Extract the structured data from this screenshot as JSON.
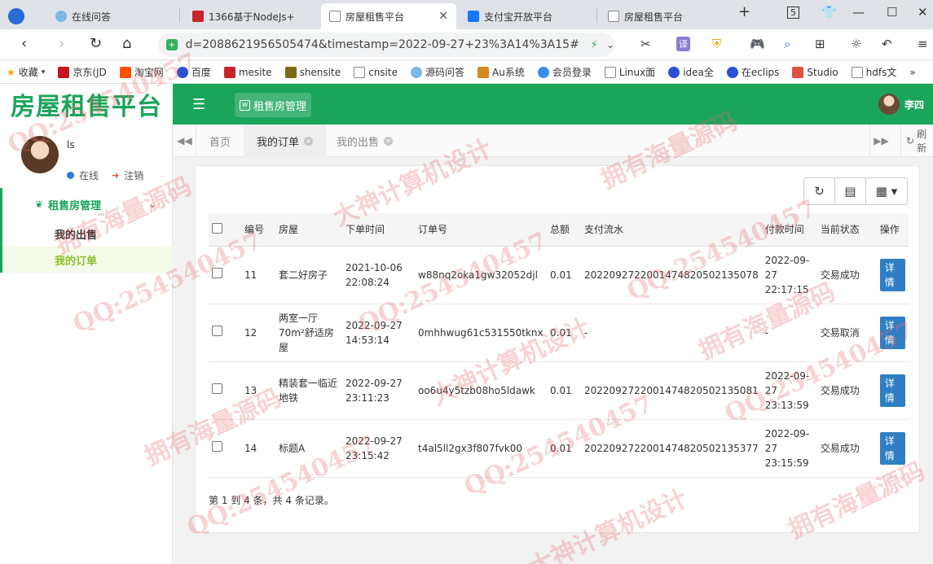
{
  "browser": {
    "tabs": [
      {
        "label": "在线问答",
        "active": false
      },
      {
        "label": "1366基于NodeJs+",
        "active": false
      },
      {
        "label": "房屋租售平台",
        "active": true
      },
      {
        "label": "支付宝开放平台",
        "active": false
      },
      {
        "label": "房屋租售平台",
        "active": false
      }
    ],
    "tab_count": "5",
    "url": "d=2088621956505474&timestamp=2022-09-27+23%3A14%3A15#",
    "bookmarks": [
      "收藏",
      "京东(JD",
      "淘宝网",
      "百度",
      "mesite",
      "shensite",
      "cnsite",
      "源码问答",
      "Au系统",
      "会员登录",
      "Linux面",
      "idea全",
      "在eclips",
      "Studio",
      "hdfs文"
    ]
  },
  "app": {
    "logo": "房屋租售平台",
    "module_tab": "租售房管理",
    "header_user": "李四",
    "sidebar": {
      "username": "ls",
      "status": "在线",
      "logout": "注销",
      "menu_parent": "租售房管理",
      "menu_items": [
        {
          "label": "我的出售",
          "active": false
        },
        {
          "label": "我的订单",
          "active": true
        }
      ]
    },
    "page_tabs": [
      {
        "label": "首页",
        "active": false,
        "closable": false
      },
      {
        "label": "我的订单",
        "active": true,
        "closable": true
      },
      {
        "label": "我的出售",
        "active": false,
        "closable": true
      }
    ],
    "refresh_label": "刷新",
    "table": {
      "headers": [
        "编号",
        "房屋",
        "下单时间",
        "订单号",
        "总额",
        "支付流水",
        "付款时间",
        "当前状态",
        "操作"
      ],
      "rows": [
        {
          "id": "11",
          "house": "套二好房子",
          "order_time": "2021-10-06 22:08:24",
          "order_no": "w88nq2oka1gw32052djl",
          "total": "0.01",
          "trade_no": "2022092722001474820502135078",
          "pay_time": "2022-09-27 22:17:15",
          "status": "交易成功",
          "action": "详情"
        },
        {
          "id": "12",
          "house": "两室一厅70m²舒适房屋",
          "order_time": "2022-09-27 14:53:14",
          "order_no": "0mhhwug61c531550tknx",
          "total": "0.01",
          "trade_no": "-",
          "pay_time": "-",
          "status": "交易取消",
          "action": "详情"
        },
        {
          "id": "13",
          "house": "精装套一临近地铁",
          "order_time": "2022-09-27 23:11:23",
          "order_no": "oo6u4y5tzb08ho5ldawk",
          "total": "0.01",
          "trade_no": "2022092722001474820502135081",
          "pay_time": "2022-09-27 23:13:59",
          "status": "交易成功",
          "action": "详情"
        },
        {
          "id": "14",
          "house": "标题A",
          "order_time": "2022-09-27 23:15:42",
          "order_no": "t4al5ll2gx3f807fvk00",
          "total": "0.01",
          "trade_no": "2022092722001474820502135377",
          "pay_time": "2022-09-27 23:15:59",
          "status": "交易成功",
          "action": "详情"
        }
      ],
      "footer": "第 1 到 4 条，共 4 条记录。"
    }
  },
  "watermarks": [
    "QQ:254540457",
    "拥有海量源码",
    "大神计算机设计"
  ],
  "colors": {
    "brand": "#1aa55a",
    "detail_button": "#2e7fc2",
    "active_menu": "#8bbf2b"
  }
}
